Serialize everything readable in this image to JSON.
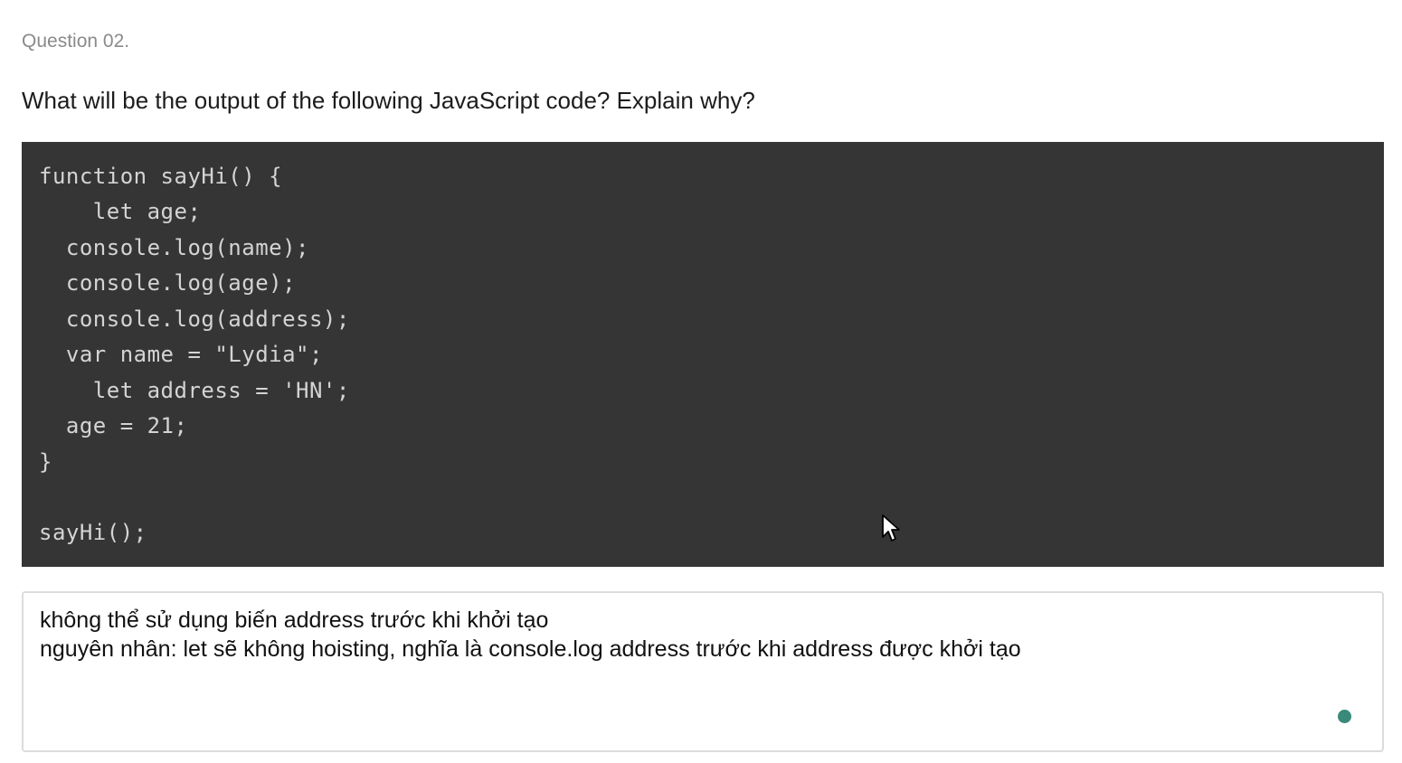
{
  "question": {
    "number": "Question 02.",
    "text": "What will be the output of the following JavaScript code? Explain why?"
  },
  "code": {
    "lines": [
      "function sayHi() {",
      "    let age;",
      "  console.log(name);",
      "  console.log(age);",
      "  console.log(address);",
      "  var name = \"Lydia\";",
      "    let address = 'HN';",
      "  age = 21;",
      "}",
      "",
      "sayHi();"
    ]
  },
  "answer": {
    "line1": "không thể sử dụng biến address trước khi khởi tạo",
    "line2": "nguyên nhân: let sẽ không hoisting, nghĩa là console.log address trước khi address được khởi tạo"
  },
  "colors": {
    "code_bg": "#353535",
    "code_text": "#d4d4d4",
    "status_dot": "#3a8a7a"
  },
  "icons": {
    "cursor": "mouse-pointer-icon",
    "status": "status-dot-icon"
  }
}
